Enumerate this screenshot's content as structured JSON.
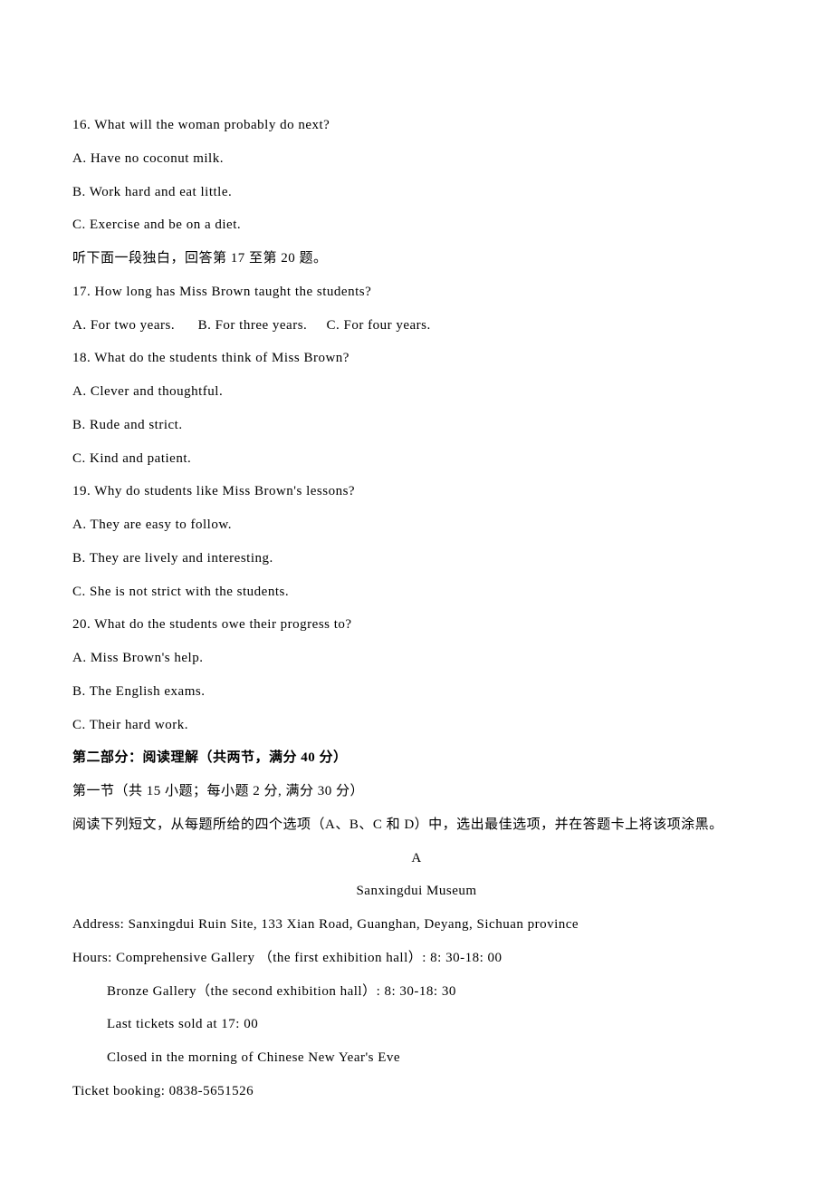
{
  "questions": {
    "q16": {
      "prompt": "16. What will the woman probably do next?",
      "a": "A. Have no coconut milk.",
      "b": "B. Work hard and eat little.",
      "c": "C. Exercise and be on a diet."
    },
    "monologue_intro": "听下面一段独白，回答第 17 至第 20 题。",
    "q17": {
      "prompt": "17. How long has Miss Brown taught the students?",
      "options_line": "A. For two years.      B. For three years.     C. For four years."
    },
    "q18": {
      "prompt": "18. What do the students think of Miss Brown?",
      "a": "A. Clever and thoughtful.",
      "b": "B. Rude and strict.",
      "c": "C. Kind and patient."
    },
    "q19": {
      "prompt": "19. Why do students like Miss Brown's lessons?",
      "a": "A. They are easy to follow.",
      "b": "B. They are lively and interesting.",
      "c": "C. She is not strict with the students."
    },
    "q20": {
      "prompt": "20. What do the students owe their progress to?",
      "a": "A. Miss Brown's help.",
      "b": "B. The English exams.",
      "c": "C. Their hard work."
    }
  },
  "section2": {
    "heading": "第二部分：阅读理解（共两节，满分 40 分）",
    "sub1": "第一节（共 15 小题；每小题 2 分, 满分 30 分）",
    "sub2": "阅读下列短文，从每题所给的四个选项（A、B、C 和 D）中，选出最佳选项，并在答题卡上将该项涂黑。",
    "passage_letter": "A"
  },
  "passageA": {
    "title": "Sanxingdui Museum",
    "address": "Address: Sanxingdui Ruin Site, 133 Xian Road, Guanghan, Deyang, Sichuan province",
    "hours_line1": "Hours: Comprehensive Gallery （the first exhibition hall）: 8: 30-18: 00",
    "hours_line2": "Bronze Gallery（the second exhibition hall）: 8: 30-18: 30",
    "hours_line3": "Last tickets sold at 17: 00",
    "hours_line4": "Closed in the morning of Chinese New Year's Eve",
    "ticket": "Ticket booking: 0838-5651526"
  }
}
